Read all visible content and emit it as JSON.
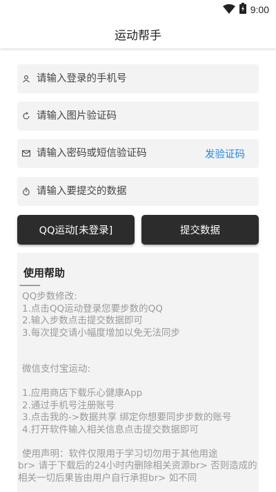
{
  "status_bar": {
    "time": "9:00",
    "icons": [
      "wifi-icon",
      "battery-charging-icon"
    ]
  },
  "app_bar": {
    "title": "运动帮手"
  },
  "form": {
    "phone": {
      "placeholder": "请输入登录的手机号",
      "icon": "user-icon"
    },
    "captcha": {
      "placeholder": "请输入图片验证码",
      "icon": "refresh-icon"
    },
    "password": {
      "placeholder": "请输入密码或短信验证码",
      "icon": "mail-icon",
      "send_code_label": "发验证码"
    },
    "steps": {
      "placeholder": "请输入要提交的数据",
      "icon": "timer-icon"
    }
  },
  "buttons": {
    "qq_login": "QQ运动[未登录]",
    "submit": "提交数据"
  },
  "colors": {
    "accent": "#1e88e5",
    "dark_button": "#2c2c2c",
    "field_bg": "#f3f3f3"
  },
  "help": {
    "title": "使用帮助",
    "divider": "----------",
    "lines": [
      "QQ步数修改:",
      "1.点击QQ运动登录您要步数的QQ",
      "2.输入步数点击提交数据即可",
      "3.每次提交请小幅度增加以免无法同步",
      "",
      "",
      "微信支付宝运动:",
      "",
      "1.应用商店下载乐心健康App",
      "2.通过手机号注册账号",
      "3.点击我的->数据共享 绑定你想要同步步数的账号",
      "4.打开软件输入相关信息点击提交数据即可",
      "",
      "使用声明：软件仅限用于学习切勿用于其他用途"
    ],
    "wrap_text": "br> 请于下载后的24小时内删除相关资源br> 否则造成的相关一切后果皆由用户自行承担br> 如不同"
  }
}
